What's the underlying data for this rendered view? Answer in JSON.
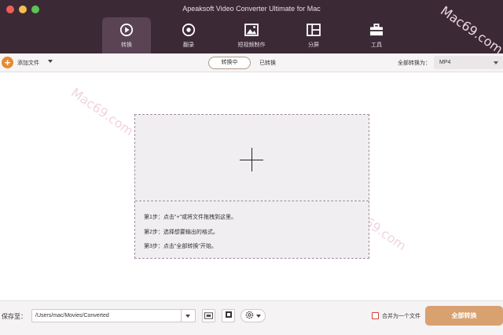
{
  "window": {
    "title": "Apeaksoft Video Converter Ultimate for Mac"
  },
  "nav": {
    "tabs": [
      {
        "label": "转换",
        "icon": "convert-icon",
        "active": true
      },
      {
        "label": "翻录",
        "icon": "disc-icon",
        "active": false
      },
      {
        "label": "短视频制作",
        "icon": "image-icon",
        "active": false
      },
      {
        "label": "分屏",
        "icon": "split-screen-icon",
        "active": false
      },
      {
        "label": "工具",
        "icon": "toolbox-icon",
        "active": false
      }
    ]
  },
  "toolbar": {
    "add_file_label": "添加文件",
    "segment_converting": "转换中",
    "segment_converted": "已转换",
    "convert_all_to_label": "全部转换为：",
    "format_value": "MP4"
  },
  "dropzone": {
    "steps": [
      "第1步：点击\"+\"或将文件拖拽到这里。",
      "第2步：选择想要输出的格式。",
      "第3步：点击\"全部转换\"开始。"
    ]
  },
  "bottom": {
    "save_to_label": "保存至：",
    "save_path": "/Users/mac/Movies/Converted",
    "merge_label": "合并为一个文件",
    "convert_all_button": "全部转换"
  },
  "watermark": {
    "text": "Mac69.com"
  },
  "colors": {
    "header_bg": "#3b2a36",
    "active_tab_bg": "#5a4353",
    "accent_orange": "#e58a33",
    "convert_button": "#d9a070"
  }
}
